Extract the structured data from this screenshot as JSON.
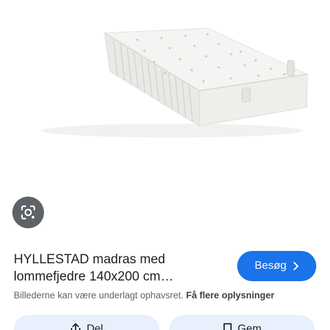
{
  "product": {
    "image_alt": "HYLLESTAD madras",
    "title_line1": "HYLLESTAD madras med",
    "title_line2": "lommefjedre 140x200 cm…"
  },
  "lens": {
    "icon": "lens-camera-icon"
  },
  "visit_button": {
    "label": "Besøg",
    "icon": "chevron-right-icon",
    "color": "#1a73e8"
  },
  "disclaimer": {
    "text": "Billederne kan være underlagt ophavsret.",
    "link": "Få flere oplysninger"
  },
  "actions": {
    "share_label": "Del",
    "share_icon": "share-icon",
    "save_label": "Gem",
    "save_icon": "bookmark-icon",
    "background": "#e8f0fe"
  }
}
